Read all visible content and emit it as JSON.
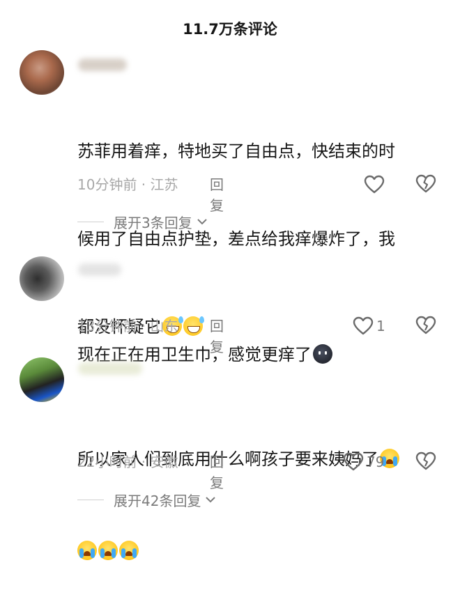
{
  "header": {
    "title": "11.7万条评论"
  },
  "comments": [
    {
      "text_line1": "苏菲用着痒，特地买了自由点，快结束的时",
      "text_line2": "候用了自由点护垫，差点给我痒爆炸了，我",
      "text_line3": "都没怀疑它",
      "emojis": [
        "laughing-sweat-emoji",
        "laughing-sweat-emoji"
      ],
      "meta": "10分钟前 · 江苏",
      "reply_label": "回复",
      "like_count": "",
      "expand_label": "展开3条回复"
    },
    {
      "text_line1": "现在正在用卫生巾，感觉更痒了",
      "emojis": [
        "dark-face-emoji"
      ],
      "meta": "13分钟前 · 山东",
      "reply_label": "回复",
      "like_count": "1"
    },
    {
      "text_line1": "所以家人们到底用什么啊孩子要来姨妈了",
      "emojis": [
        "crying-emoji",
        "crying-emoji",
        "crying-emoji",
        "crying-emoji"
      ],
      "meta": "22小时前 · 安徽",
      "reply_label": "回复",
      "like_count": "79",
      "expand_label": "展开42条回复"
    }
  ],
  "colors": {
    "text": "#161616",
    "meta": "#a8a8a8",
    "action": "#7a7a7a"
  }
}
